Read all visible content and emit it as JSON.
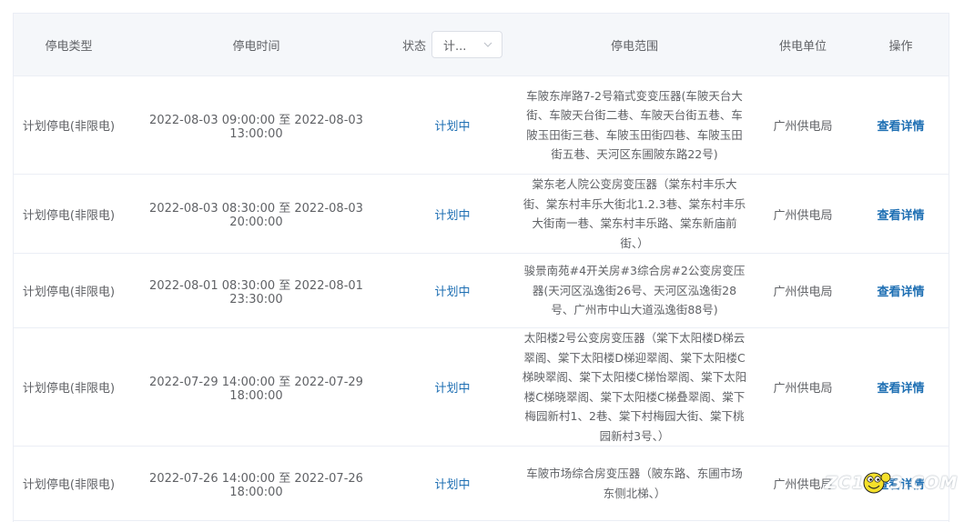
{
  "table": {
    "headers": {
      "type": "停电类型",
      "time": "停电时间",
      "status": "状态",
      "range": "停电范围",
      "unit": "供电单位",
      "action": "操作"
    },
    "status_filter": {
      "value": "计...",
      "chevron_icon": "chevron-down-icon"
    },
    "rows": [
      {
        "type": "计划停电(非限电)",
        "time": "2022-08-03 09:00:00 至 2022-08-03 13:00:00",
        "status": "计划中",
        "range": "车陂东岸路7-2号箱式变变压器(车陂天台大街、车陂天台街二巷、车陂天台街五巷、车陂玉田街三巷、车陂玉田街四巷、车陂玉田街五巷、天河区东圃陂东路22号)",
        "unit": "广州供电局",
        "action": "查看详情"
      },
      {
        "type": "计划停电(非限电)",
        "time": "2022-08-03 08:30:00 至 2022-08-03 20:00:00",
        "status": "计划中",
        "range": "棠东老人院公变房变压器（棠东村丰乐大街、棠东村丰乐大街北1.2.3巷、棠东村丰乐大街南一巷、棠东村丰乐路、棠东新庙前街、）",
        "unit": "广州供电局",
        "action": "查看详情"
      },
      {
        "type": "计划停电(非限电)",
        "time": "2022-08-01 08:30:00 至 2022-08-01 23:30:00",
        "status": "计划中",
        "range": "骏景南苑#4开关房#3综合房#2公变房变压器(天河区泓逸街26号、天河区泓逸街28号、广州市中山大道泓逸街88号)",
        "unit": "广州供电局",
        "action": "查看详情"
      },
      {
        "type": "计划停电(非限电)",
        "time": "2022-07-29 14:00:00 至 2022-07-29 18:00:00",
        "status": "计划中",
        "range": "太阳楼2号公变房变压器（棠下太阳楼D梯云翠阁、棠下太阳楼D梯迎翠阁、棠下太阳楼C梯映翠阁、棠下太阳楼C梯怡翠阁、棠下太阳楼C梯晓翠阁、棠下太阳楼C梯叠翠阁、棠下梅园新村1、2巷、棠下村梅园大街、棠下桃园新村3号、）",
        "unit": "广州供电局",
        "action": "查看详情"
      },
      {
        "type": "计划停电(非限电)",
        "time": "2022-07-26 14:00:00 至 2022-07-26 18:00:00",
        "status": "计划中",
        "range": "车陂市场综合房变压器（陂东路、东圃市场东侧北梯、）",
        "unit": "广州供电局",
        "action": "查看详情"
      }
    ]
  },
  "watermark": {
    "text_left": "ZC1",
    "text_right": "3.COM"
  }
}
